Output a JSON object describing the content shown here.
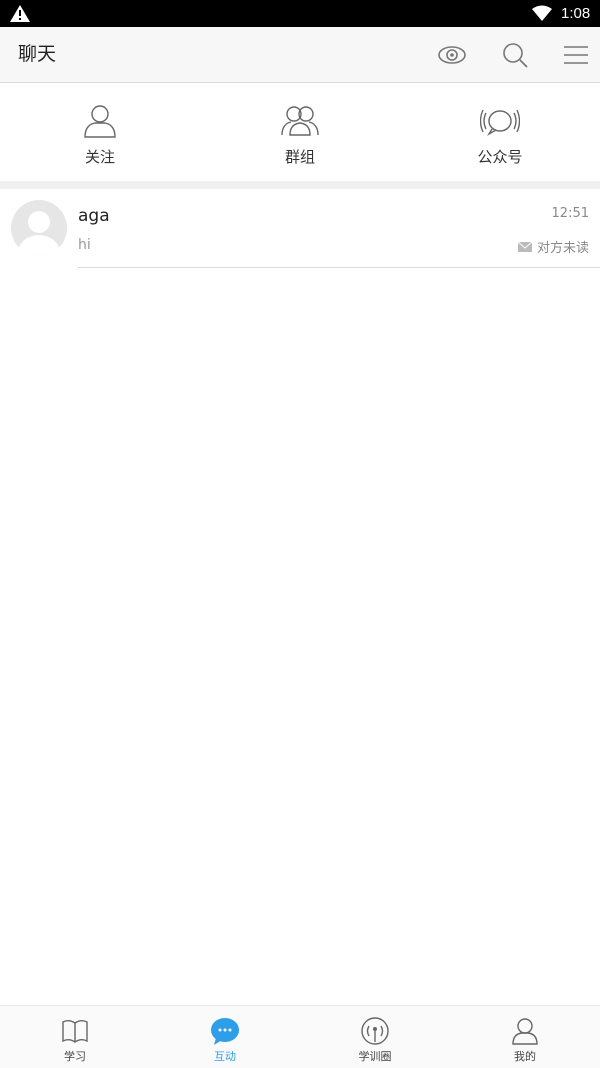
{
  "status_bar": {
    "time": "1:08"
  },
  "header": {
    "title": "聊天"
  },
  "categories": [
    {
      "label": "关注",
      "icon": "person-icon"
    },
    {
      "label": "群组",
      "icon": "group-icon"
    },
    {
      "label": "公众号",
      "icon": "broadcast-icon"
    }
  ],
  "chats": [
    {
      "name": "aga",
      "time": "12:51",
      "preview": "hi",
      "status": "对方未读"
    }
  ],
  "bottom_nav": [
    {
      "label": "学习",
      "icon": "book-icon",
      "active": false
    },
    {
      "label": "互动",
      "icon": "chat-bubble-icon",
      "active": true
    },
    {
      "label": "学训圈",
      "icon": "signal-icon",
      "active": false
    },
    {
      "label": "我的",
      "icon": "profile-icon",
      "active": false
    }
  ],
  "colors": {
    "accent": "#2d9ee8",
    "header_bg": "#f7f7f7"
  }
}
